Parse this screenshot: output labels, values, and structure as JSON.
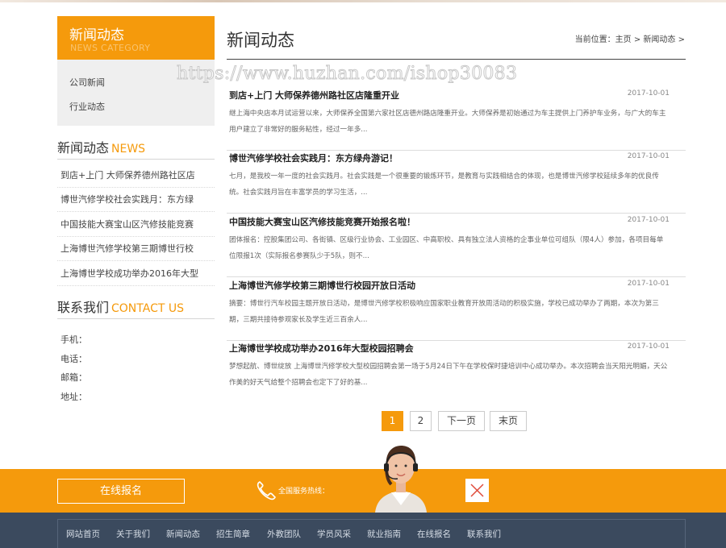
{
  "sidebar": {
    "category_title": "新闻动态",
    "category_subtitle": "NEWS CATEGORY",
    "categories": [
      "公司新闻",
      "行业动态"
    ],
    "news_heading_cn": "新闻动态",
    "news_heading_en": "NEWS",
    "news_items": [
      "到店+上门 大师保养德州路社区店",
      "博世汽修学校社会实践月：东方绿",
      "中国技能大赛宝山区汽修技能竞赛",
      "上海博世汽修学校第三期博世行校",
      "上海博世学校成功举办2016年大型"
    ],
    "contact_heading_cn": "联系我们",
    "contact_heading_en": "CONTACT US",
    "contact_lines": [
      "手机：",
      "电话：",
      "邮箱：",
      "地址："
    ]
  },
  "main": {
    "title": "新闻动态",
    "breadcrumb": [
      "当前位置：",
      "主页",
      ">",
      "新闻动态",
      ">"
    ],
    "watermark": "https://www.huzhan.com/ishop30083",
    "articles": [
      {
        "title": "到店+上门 大师保养德州路社区店隆重开业",
        "date": "2017-10-01",
        "summary": "继上海中央店本月试运营以来，大师保养全国第六家社区店德州路店隆重开业。大师保养是初始通过为车主提供上门养护车业务，与广大的车主用户建立了非常好的服务粘性，经过一年多..."
      },
      {
        "title": "博世汽修学校社会实践月：东方绿舟游记！",
        "date": "2017-10-01",
        "summary": "七月，是我校一年一度的社会实践月。社会实践是一个很重要的锻炼环节，是教育与实践相结合的体现，也是博世汽修学校延续多年的优良传统。社会实践月旨在丰富学员的学习生活，..."
      },
      {
        "title": "中国技能大赛宝山区汽修技能竞赛开始报名啦！",
        "date": "2017-10-01",
        "summary": "团体报名：控股集团公司、各街镇、区级行业协会、工业园区、中高职校、具有独立法人资格的企事业单位可组队（限4人）参加，各项目每单位限报1次（实际报名参赛队少于5队，则不..."
      },
      {
        "title": "上海博世汽修学校第三期博世行校园开放日活动",
        "date": "2017-10-01",
        "summary": "摘要：博世行汽车校园主题开放日活动，是博世汽修学校积极响应国家职业教育开放周活动的积极实施，学校已成功举办了两期，本次为第三期，三期共接待参观家长及学生近三百余人..."
      },
      {
        "title": "上海博世学校成功举办2016年大型校园招聘会",
        "date": "2017-10-01",
        "summary": "梦想起航、博世绽放 上海博世汽修学校大型校园招聘会第一场于5月24日下午在学校保时捷培训中心成功举办。本次招聘会当天阳光明媚，天公作美的好天气给整个招聘会也定下了好的基..."
      }
    ],
    "pagination": [
      "1",
      "2",
      "下一页",
      "末页"
    ]
  },
  "footer": {
    "signup_label": "在线报名",
    "hotline_label": "全国服务热线：",
    "nav_items": [
      "网站首页",
      "关于我们",
      "新闻动态",
      "招生简章",
      "外教团队",
      "学员风采",
      "就业指南",
      "在线报名",
      "联系我们"
    ]
  },
  "colors": {
    "accent": "#f59a0c",
    "nav_bg": "#3b4a5e"
  },
  "icons": [
    "phone-icon",
    "close-icon",
    "customer-service-agent-image"
  ]
}
